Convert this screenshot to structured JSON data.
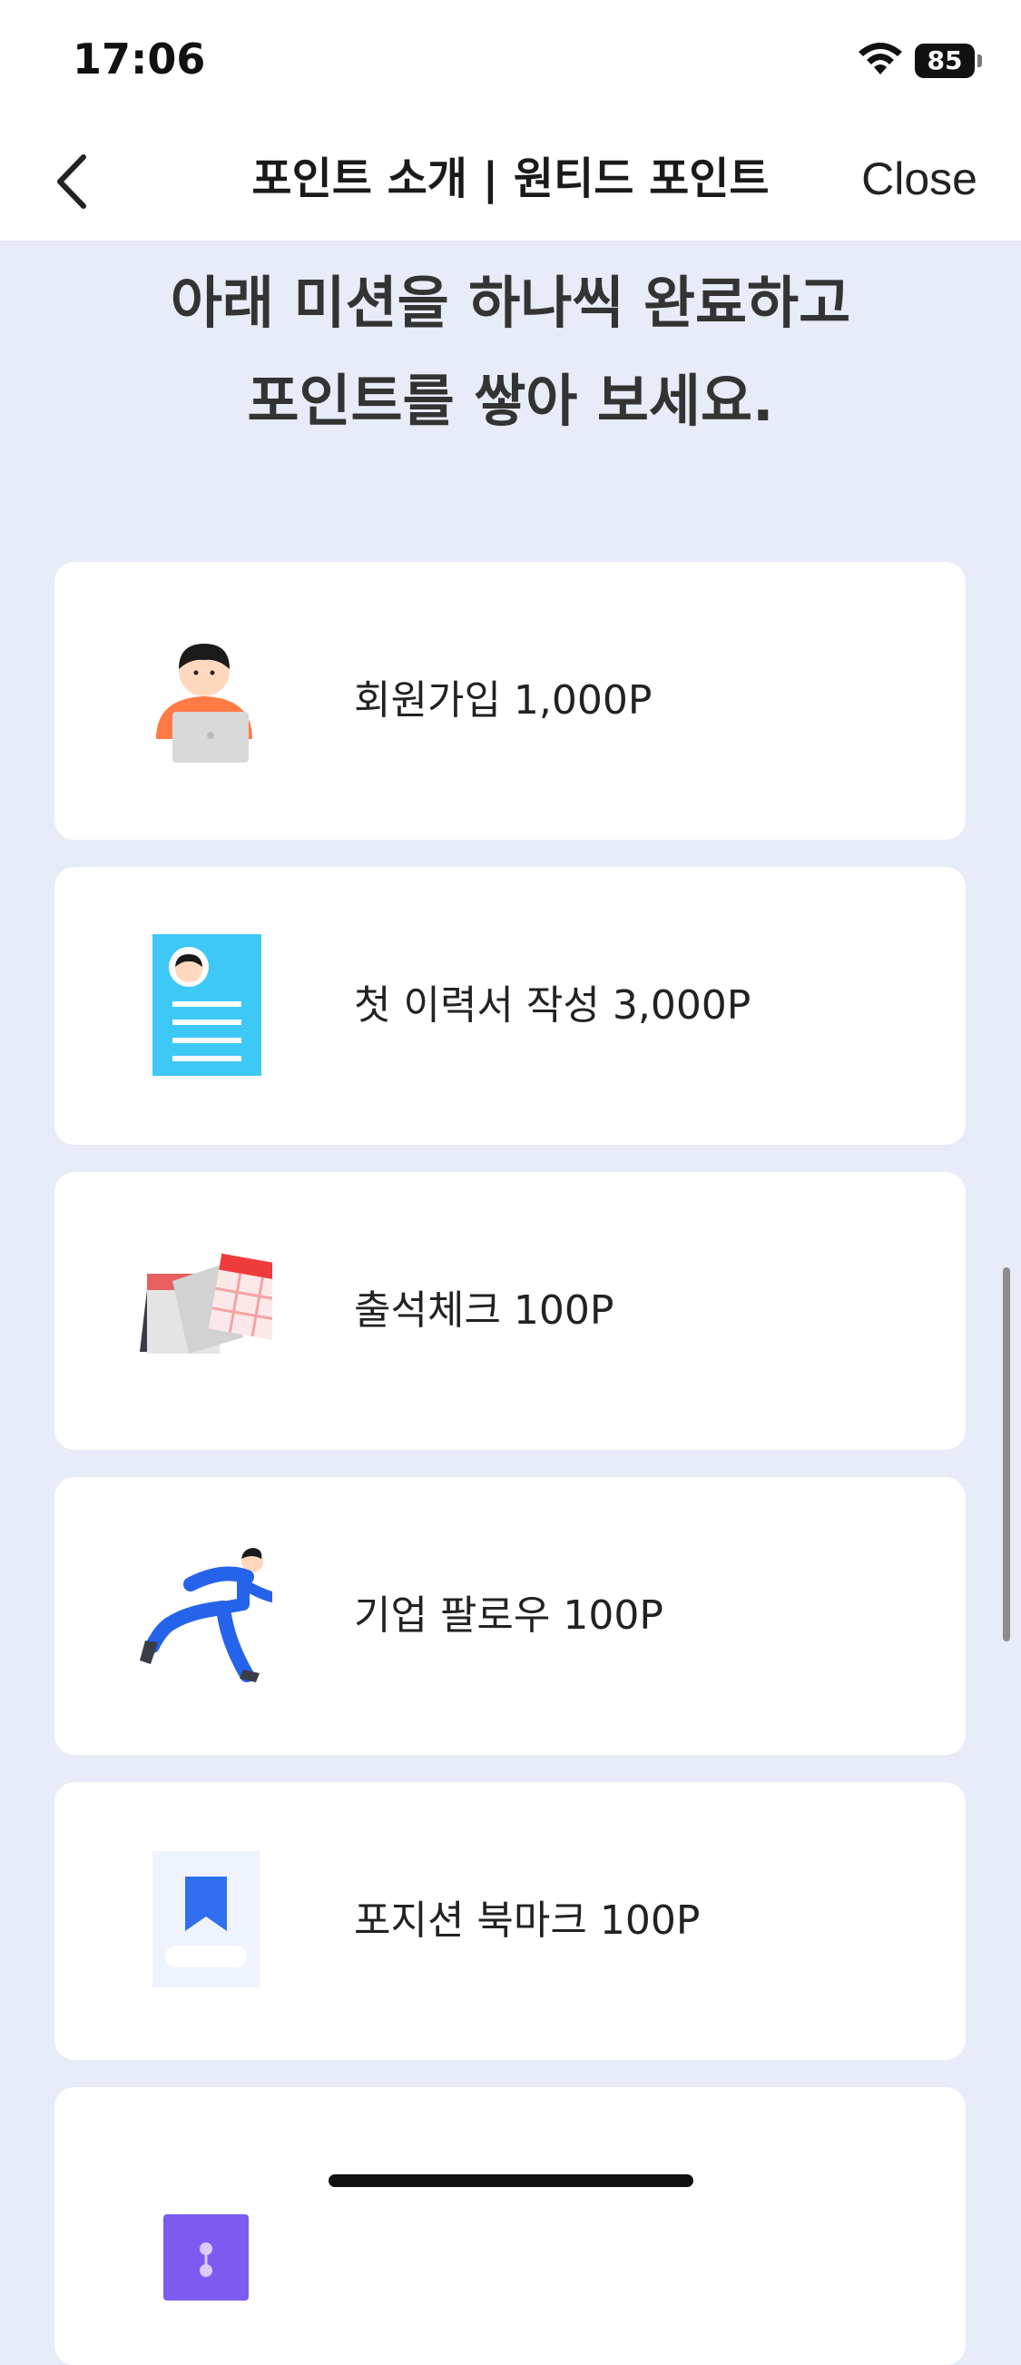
{
  "status_bar": {
    "time": "17:06",
    "battery": "85"
  },
  "nav": {
    "title": "포인트 소개 | 원티드 포인트",
    "close_label": "Close"
  },
  "headline": {
    "line1": "아래 미션을 하나씩 완료하고",
    "line2": "포인트를 쌓아 보세요."
  },
  "missions": [
    {
      "label": "회원가입 1,000P",
      "icon": "person-laptop-icon"
    },
    {
      "label": "첫 이력서 작성 3,000P",
      "icon": "resume-document-icon"
    },
    {
      "label": "출석체크 100P",
      "icon": "calendar-icon"
    },
    {
      "label": "기업 팔로우 100P",
      "icon": "running-person-icon"
    },
    {
      "label": "포지션 북마크 100P",
      "icon": "bookmark-icon"
    },
    {
      "label": "",
      "icon": "envelope-icon"
    }
  ],
  "colors": {
    "background": "#e8ebf8",
    "card": "#ffffff",
    "accent_blue": "#3b82f6",
    "cyan": "#3ec8f6"
  }
}
